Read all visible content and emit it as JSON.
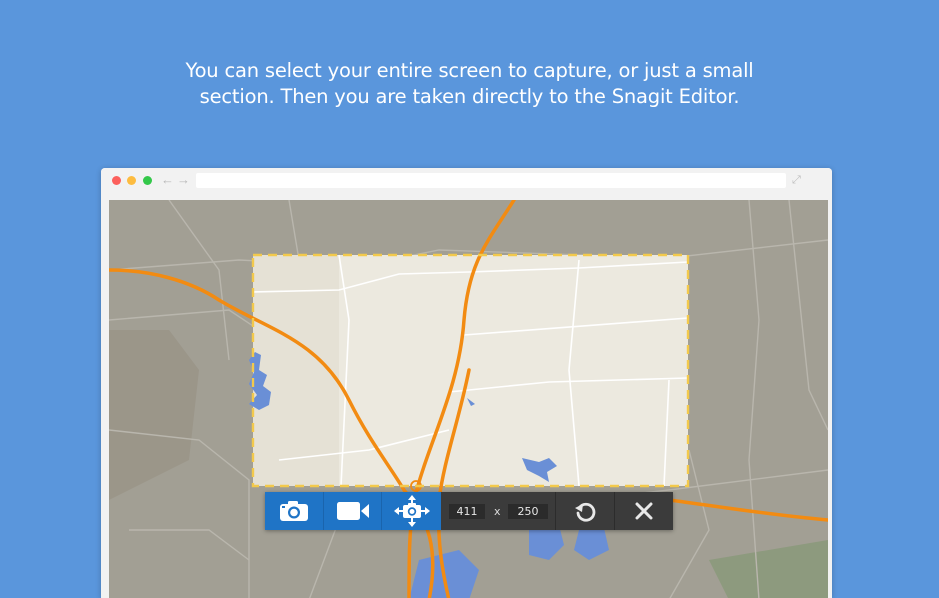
{
  "headline": {
    "line1": "You can select your entire screen to capture, or just a small",
    "line2": "section. Then you are taken directly to the Snagit Editor."
  },
  "browser": {
    "traffic_lights": [
      "close",
      "minimize",
      "zoom"
    ],
    "nav_back_icon": "←",
    "nav_forward_icon": "→",
    "url": "",
    "expand_icon": "⤢"
  },
  "capture_toolbar": {
    "buttons": [
      {
        "name": "image-capture",
        "icon": "camera-icon"
      },
      {
        "name": "video-capture",
        "icon": "video-camera-icon"
      },
      {
        "name": "move-selection",
        "icon": "move-camera-icon"
      }
    ],
    "width": "411",
    "times": "x",
    "height": "250",
    "restart_icon": "restart-icon",
    "close_icon": "close-icon"
  },
  "colors": {
    "background": "#5a96dc",
    "toolbar_blue": "#1f74c6",
    "toolbar_dark": "#3b3b3b",
    "selection_border": "#f2c94c",
    "road": "#f28b12",
    "water": "#6a8fd6"
  }
}
